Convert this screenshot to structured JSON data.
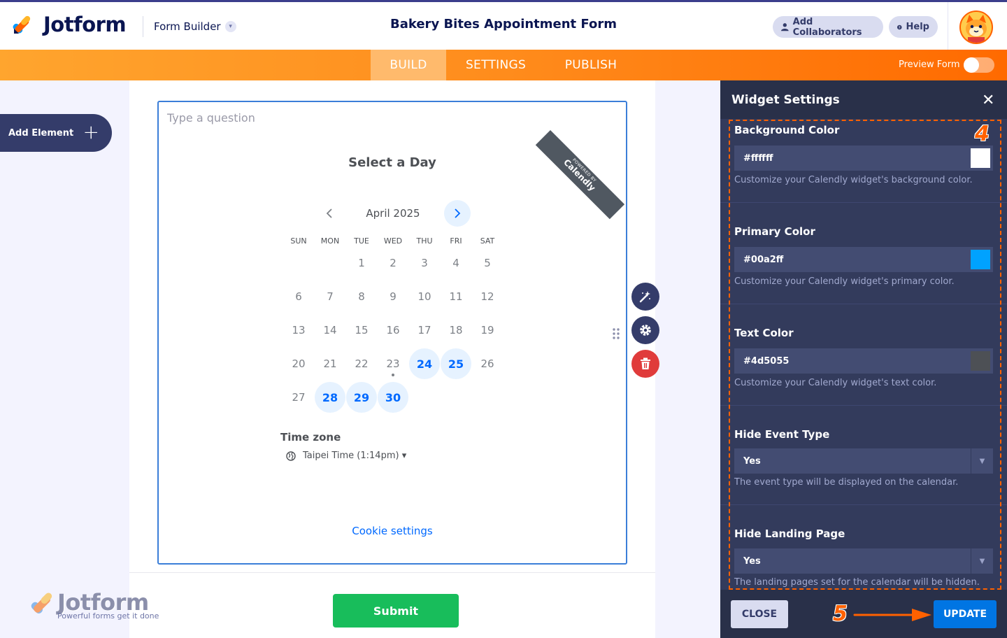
{
  "header": {
    "brand": "Jotform",
    "builder_label": "Form Builder",
    "form_title": "Bakery Bites Appointment Form",
    "add_collaborators": "Add Collaborators",
    "help": "Help"
  },
  "nav": {
    "tabs": [
      {
        "label": "BUILD",
        "active": true
      },
      {
        "label": "SETTINGS",
        "active": false
      },
      {
        "label": "PUBLISH",
        "active": false
      }
    ],
    "preview_label": "Preview Form",
    "preview_on": false
  },
  "sidebar": {
    "add_element": "Add Element"
  },
  "widget": {
    "question_placeholder": "Type a question",
    "ribbon_small": "POWERED BY",
    "ribbon_brand": "Calendly",
    "select_day": "Select a Day",
    "month": "April 2025",
    "weekdays": [
      "SUN",
      "MON",
      "TUE",
      "WED",
      "THU",
      "FRI",
      "SAT"
    ],
    "weeks": [
      [
        "",
        "",
        "1",
        "2",
        "3",
        "4",
        "5"
      ],
      [
        "6",
        "7",
        "8",
        "9",
        "10",
        "11",
        "12"
      ],
      [
        "13",
        "14",
        "15",
        "16",
        "17",
        "18",
        "19"
      ],
      [
        "20",
        "21",
        "22",
        "23",
        "24",
        "25",
        "26"
      ],
      [
        "27",
        "28",
        "29",
        "30",
        "",
        "",
        ""
      ]
    ],
    "available_days": [
      "24",
      "25",
      "28",
      "29",
      "30"
    ],
    "today": "23",
    "timezone_label": "Time zone",
    "timezone_value": "Taipei Time (1:14pm) ▾",
    "cookie_settings": "Cookie settings"
  },
  "form": {
    "submit": "Submit"
  },
  "watermark": {
    "brand": "Jotform",
    "tagline": "Powerful forms get it done"
  },
  "panel": {
    "title": "Widget Settings",
    "settings": [
      {
        "label": "Background Color",
        "value": "#ffffff",
        "swatch": "#ffffff",
        "desc": "Customize your Calendly widget's background color."
      },
      {
        "label": "Primary Color",
        "value": "#00a2ff",
        "swatch": "#00a2ff",
        "desc": "Customize your Calendly widget's primary color."
      },
      {
        "label": "Text Color",
        "value": "#4d5055",
        "swatch": "#4d5055",
        "desc": "Customize your Calendly widget's text color."
      },
      {
        "label": "Hide Event Type",
        "value": "Yes",
        "desc": "The event type will be displayed on the calendar."
      },
      {
        "label": "Hide Landing Page",
        "value": "Yes",
        "desc": "The landing pages set for the calendar will be hidden."
      }
    ],
    "close_button": "CLOSE",
    "update_button": "UPDATE",
    "step_4": "4",
    "step_5": "5"
  },
  "colors": {
    "accent_orange": "#ff6100",
    "calendly_blue": "#0069ff",
    "submit_green": "#18bd5b",
    "panel_bg": "#293049"
  }
}
